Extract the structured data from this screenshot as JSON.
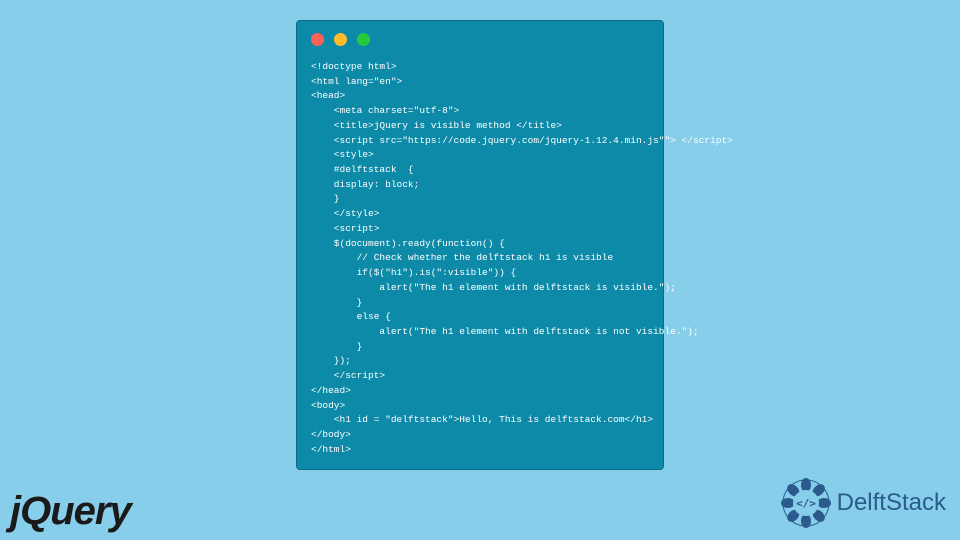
{
  "window": {
    "controls": [
      "red",
      "yellow",
      "green"
    ]
  },
  "code": {
    "lines": [
      "<!doctype html>",
      "<html lang=\"en\">",
      "<head>",
      "    <meta charset=\"utf-8\">",
      "    <title>jQuery is visible method </title>",
      "    <script src=\"https://code.jquery.com/jquery-1.12.4.min.js\"\"> </script>",
      "    <style>",
      "    #delftstack  {",
      "    display: block;",
      "    }",
      "    </style>",
      "    <script>",
      "    $(document).ready(function() {",
      "        // Check whether the delftstack h1 is visible",
      "        if($(\"h1\").is(\":visible\")) {",
      "            alert(\"The h1 element with delftstack is visible.\");",
      "        }",
      "        else {",
      "            alert(\"The h1 element with delftstack is not visible.\");",
      "        }",
      "    });",
      "    </script>",
      "</head>",
      "<body>",
      "    <h1 id = \"delftstack\">Hello, This is delftstack.com</h1>",
      "</body>",
      "</html>"
    ]
  },
  "logos": {
    "jquery": "jQuery",
    "delftstack": "DelftStack"
  }
}
